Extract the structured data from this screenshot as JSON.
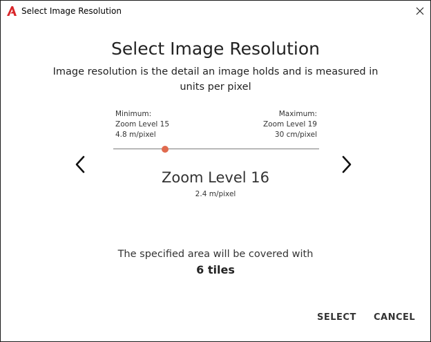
{
  "window": {
    "title": "Select Image Resolution",
    "app_icon": "autocad-a-icon",
    "close_icon": "close-icon"
  },
  "content": {
    "heading": "Select Image Resolution",
    "description": "Image resolution is the detail an image holds and is measured in units per pixel"
  },
  "range": {
    "minimum": {
      "label": "Minimum:",
      "level": "Zoom Level 15",
      "resolution": "4.8 m/pixel"
    },
    "maximum": {
      "label": "Maximum:",
      "level": "Zoom Level 19",
      "resolution": "30 cm/pixel"
    },
    "slider": {
      "min": 15,
      "max": 19,
      "value": 16
    }
  },
  "selection": {
    "level": "Zoom Level 16",
    "resolution": "2.4 m/pixel"
  },
  "coverage": {
    "text": "The specified area will be covered with",
    "tiles": "6 tiles"
  },
  "buttons": {
    "select": "SELECT",
    "cancel": "CANCEL"
  },
  "colors": {
    "accent": "#e06a4e",
    "app_icon": "#d9262a"
  }
}
